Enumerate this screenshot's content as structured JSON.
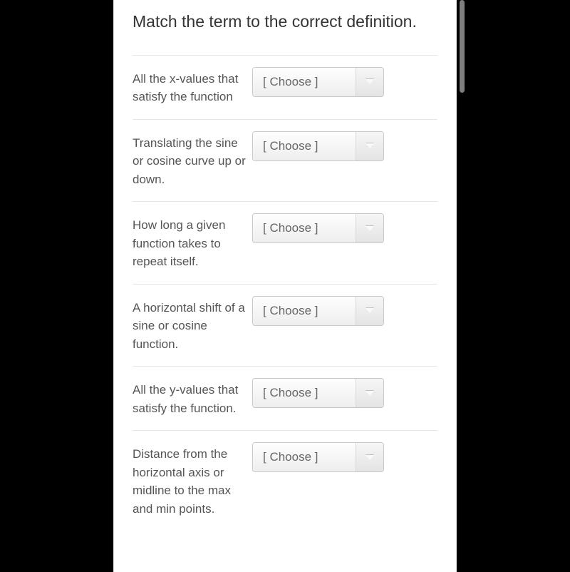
{
  "question": {
    "prompt": "Match the term to the correct definition."
  },
  "dropdown_placeholder": "[ Choose ]",
  "items": [
    {
      "definition": "All the x-values that satisfy the function"
    },
    {
      "definition": "Translating the sine or cosine curve up or down."
    },
    {
      "definition": "How long a given function takes to repeat itself."
    },
    {
      "definition": "A horizontal shift of a sine or cosine function."
    },
    {
      "definition": "All the y-values that satisfy the function."
    },
    {
      "definition": "Distance from the horizontal axis or midline to the max and min points."
    }
  ]
}
